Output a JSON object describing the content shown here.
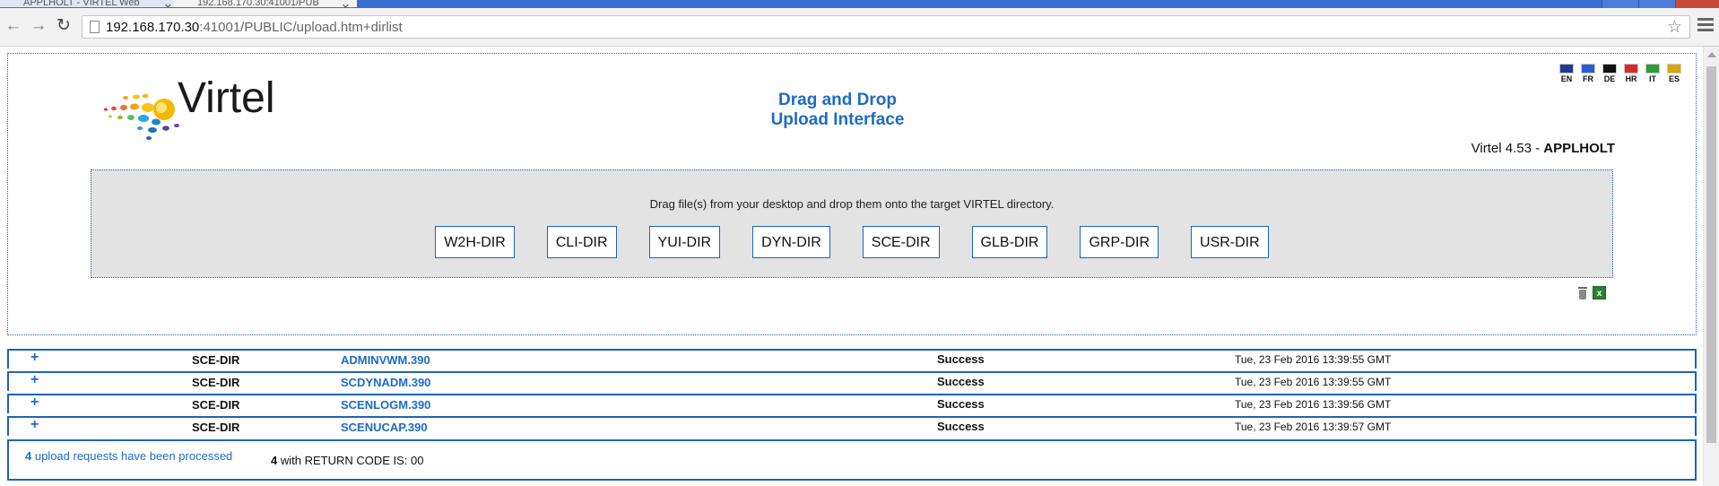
{
  "browser": {
    "tabs": [
      {
        "title": "APPLHOLT - VIRTEL Web"
      },
      {
        "title": "192.168.170.30:41001/PUB"
      }
    ],
    "url_host": "192.168.170.30",
    "url_rest": ":41001/PUBLIC/upload.htm+dirlist"
  },
  "header": {
    "logo_text": "Virtel",
    "title_line1": "Drag and Drop",
    "title_line2": "Upload Interface",
    "version_prefix": "Virtel 4.53 - ",
    "version_app": "APPLHOLT",
    "languages": [
      {
        "code": "EN",
        "color": "#1f3a93"
      },
      {
        "code": "FR",
        "color": "#2a5bd7"
      },
      {
        "code": "DE",
        "color": "#111111"
      },
      {
        "code": "HR",
        "color": "#d42b2b"
      },
      {
        "code": "IT",
        "color": "#2e9a3a"
      },
      {
        "code": "ES",
        "color": "#d6a514"
      }
    ]
  },
  "drop_zone": {
    "instructions": "Drag file(s) from your desktop and drop them onto the target VIRTEL directory.",
    "directories": [
      "W2H-DIR",
      "CLI-DIR",
      "YUI-DIR",
      "DYN-DIR",
      "SCE-DIR",
      "GLB-DIR",
      "GRP-DIR",
      "USR-DIR"
    ]
  },
  "uploads": [
    {
      "expand": "+",
      "dir": "SCE-DIR",
      "file": "ADMINVWM.390",
      "status": "Success",
      "time": "Tue, 23 Feb 2016 13:39:55 GMT"
    },
    {
      "expand": "+",
      "dir": "SCE-DIR",
      "file": "SCDYNADM.390",
      "status": "Success",
      "time": "Tue, 23 Feb 2016 13:39:55 GMT"
    },
    {
      "expand": "+",
      "dir": "SCE-DIR",
      "file": "SCENLOGM.390",
      "status": "Success",
      "time": "Tue, 23 Feb 2016 13:39:56 GMT"
    },
    {
      "expand": "+",
      "dir": "SCE-DIR",
      "file": "SCENUCAP.390",
      "status": "Success",
      "time": "Tue, 23 Feb 2016 13:39:57 GMT"
    }
  ],
  "summary": {
    "count": "4",
    "processed_text": " upload requests have been processed",
    "rc_count": "4",
    "rc_text": " with RETURN CODE IS: 00"
  },
  "colors": {
    "accent": "#1e6bc4",
    "border": "#1e64b4",
    "drop_bg": "#e3e3e3"
  }
}
